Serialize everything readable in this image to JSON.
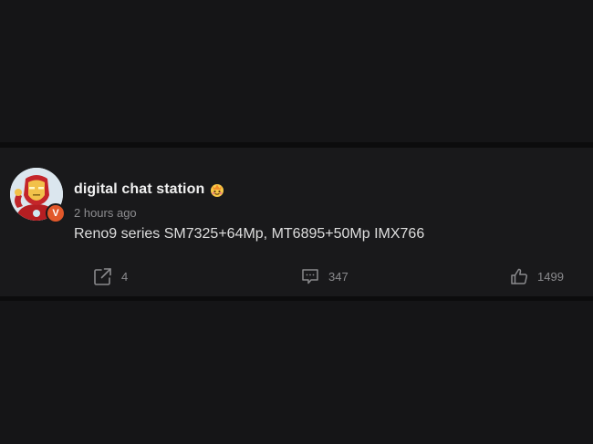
{
  "post": {
    "username": "digital chat station",
    "verified_badge": "V",
    "timestamp": "2 hours ago",
    "text": "Reno9 series SM7325+64Mp, MT6895+50Mp IMX766",
    "actions": {
      "share_count": "4",
      "comment_count": "347",
      "like_count": "1499"
    }
  },
  "icons": {
    "share": "share-icon",
    "comment": "comment-icon",
    "like": "thumbs-up-icon",
    "badge": "crown-emoji-icon"
  },
  "colors": {
    "background": "#151517",
    "card": "#19191b",
    "text_primary": "#f0f0f0",
    "text_secondary": "#8d8d90",
    "badge": "#e2582a"
  }
}
